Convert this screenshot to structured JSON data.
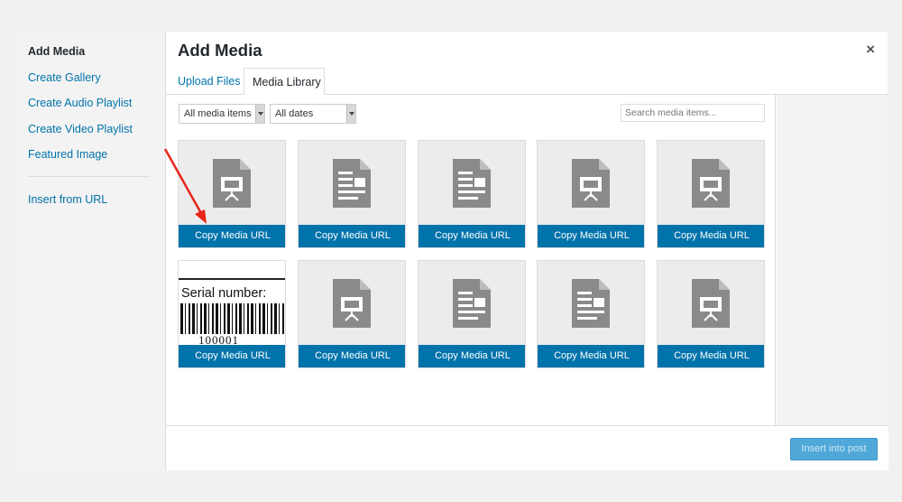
{
  "left_menu": {
    "items": [
      {
        "label": "Add Media",
        "active": true
      },
      {
        "label": "Create Gallery"
      },
      {
        "label": "Create Audio Playlist"
      },
      {
        "label": "Create Video Playlist"
      },
      {
        "label": "Featured Image"
      },
      {
        "label": "Insert from URL"
      }
    ]
  },
  "modal": {
    "title": "Add Media",
    "close_glyph": "×",
    "tabs": [
      {
        "label": "Upload Files"
      },
      {
        "label": "Media Library",
        "active": true
      }
    ],
    "filters": {
      "type_selected": "All media items",
      "date_selected": "All dates"
    },
    "search": {
      "placeholder": "Search media items..."
    },
    "tile_caption": "Copy Media URL",
    "tiles": [
      {
        "icon": "presentation-doc-icon",
        "caption": "Copy Media URL"
      },
      {
        "icon": "text-doc-icon",
        "caption": "Copy Media URL"
      },
      {
        "icon": "text-doc-icon",
        "caption": "Copy Media URL"
      },
      {
        "icon": "presentation-doc-icon",
        "caption": "Copy Media URL"
      },
      {
        "icon": "presentation-doc-icon",
        "caption": "Copy Media URL"
      },
      {
        "icon": "barcode-image",
        "caption": "Copy Media URL",
        "image_text": "Serial number:",
        "barcode_number": "100001"
      },
      {
        "icon": "presentation-doc-icon",
        "caption": "Copy Media URL"
      },
      {
        "icon": "text-doc-icon",
        "caption": "Copy Media URL"
      },
      {
        "icon": "text-doc-icon",
        "caption": "Copy Media URL"
      },
      {
        "icon": "presentation-doc-icon",
        "caption": "Copy Media URL"
      }
    ],
    "footer": {
      "insert_label": "Insert into post"
    }
  },
  "colors": {
    "accent": "#0073aa",
    "annotation_arrow": "#e8261c",
    "icon_gray": "#8a8a8a"
  }
}
